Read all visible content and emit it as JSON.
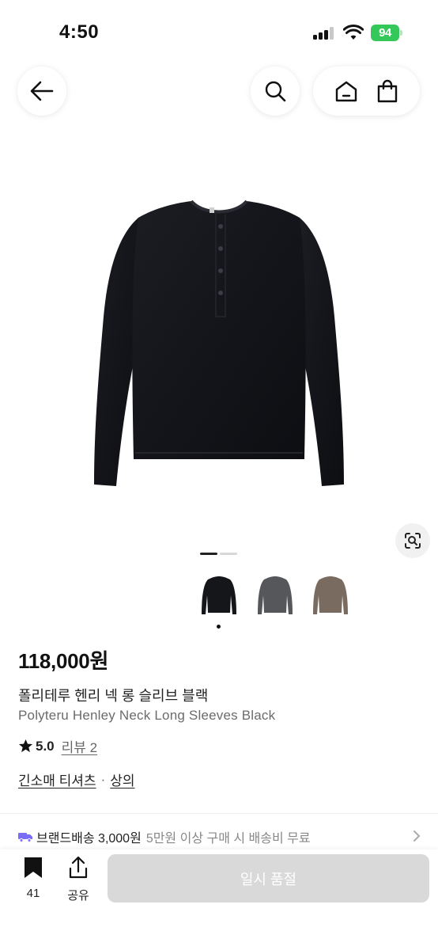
{
  "status_bar": {
    "time": "4:50",
    "battery": "94"
  },
  "nav": {
    "back_icon": "arrow-left-icon",
    "search_icon": "search-icon",
    "home_icon": "home-icon",
    "cart_icon": "shopping-bag-icon"
  },
  "gallery": {
    "current_index": 1,
    "total_images": 2,
    "colors": [
      {
        "name": "black",
        "swatch": "#15161a",
        "selected": true
      },
      {
        "name": "charcoal",
        "swatch": "#55575a",
        "selected": false
      },
      {
        "name": "brown",
        "swatch": "#7a6b61",
        "selected": false
      }
    ]
  },
  "product": {
    "price": "118,000원",
    "name_ko": "폴리테루 헨리 넥 롱 슬리브 블랙",
    "name_en": "Polyteru Henley Neck Long Sleeves Black",
    "rating": "5.0",
    "review_label": "리뷰 2",
    "category_primary": "긴소매 티셔츠",
    "category_separator": "·",
    "category_secondary": "상의"
  },
  "shipping": {
    "brand_label": "브랜드배송 3,000원",
    "note": "5만원 이상 구매 시 배송비 무료",
    "icon_color": "#7b6cf6"
  },
  "bottom_bar": {
    "bookmark_count": "41",
    "share_label": "공유",
    "buy_label": "일시 품절"
  }
}
